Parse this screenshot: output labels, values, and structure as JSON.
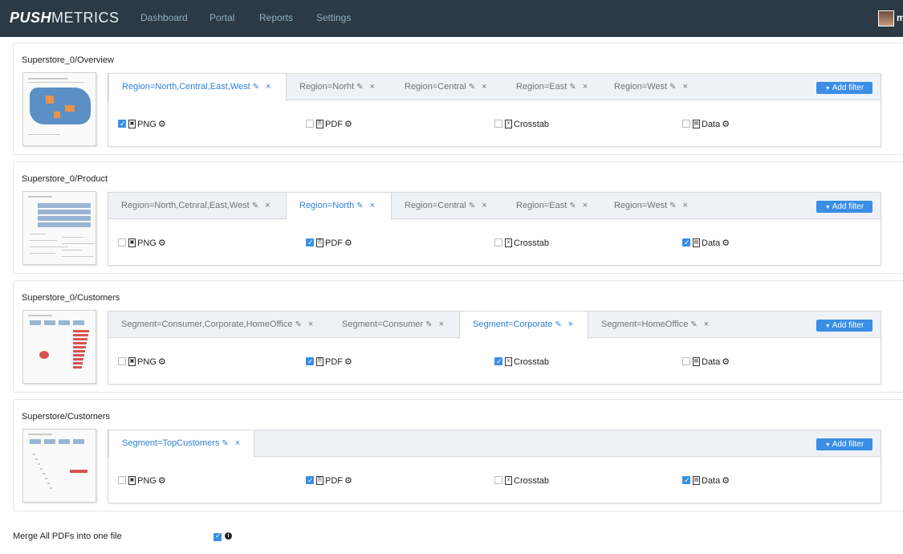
{
  "brand": {
    "bold": "PUSH",
    "light": "METRICS"
  },
  "nav": [
    "Dashboard",
    "Portal",
    "Reports",
    "Settings"
  ],
  "user_initial": "m",
  "sections": [
    {
      "title": "Superstore_0/Overview",
      "tabs": [
        "Region=North,Central,East,West",
        "Region=Norht",
        "Region=Central",
        "Region=East",
        "Region=West"
      ],
      "active_tab": 0,
      "add_filter": "Add filter",
      "options": [
        {
          "label": "PNG",
          "checked": true,
          "gear": true
        },
        {
          "label": "PDF",
          "checked": false,
          "gear": true
        },
        {
          "label": "Crosstab",
          "checked": false,
          "gear": false
        },
        {
          "label": "Data",
          "checked": false,
          "gear": true
        }
      ]
    },
    {
      "title": "Superstore_0/Product",
      "tabs": [
        "Region=North,Cetnral,East,West",
        "Region=North",
        "Region=Central",
        "Region=East",
        "Region=West"
      ],
      "active_tab": 1,
      "add_filter": "Add filter",
      "options": [
        {
          "label": "PNG",
          "checked": false,
          "gear": true
        },
        {
          "label": "PDF",
          "checked": true,
          "gear": true
        },
        {
          "label": "Crosstab",
          "checked": false,
          "gear": false
        },
        {
          "label": "Data",
          "checked": true,
          "gear": true
        }
      ]
    },
    {
      "title": "Superstore_0/Customers",
      "tabs": [
        "Segment=Consumer,Corporate,HomeOffice",
        "Segment=Consumer",
        "Segment=Corporate",
        "Segment=HomeOffice"
      ],
      "active_tab": 2,
      "add_filter": "Add filter",
      "options": [
        {
          "label": "PNG",
          "checked": false,
          "gear": true
        },
        {
          "label": "PDF",
          "checked": true,
          "gear": true
        },
        {
          "label": "Crosstab",
          "checked": true,
          "gear": false
        },
        {
          "label": "Data",
          "checked": false,
          "gear": true
        }
      ]
    },
    {
      "title": "Superstore/Customers",
      "tabs": [
        "Segment=TopCustomers"
      ],
      "active_tab": 0,
      "add_filter": "Add filter",
      "options": [
        {
          "label": "PNG",
          "checked": false,
          "gear": true
        },
        {
          "label": "PDF",
          "checked": true,
          "gear": true
        },
        {
          "label": "Crosstab",
          "checked": false,
          "gear": false
        },
        {
          "label": "Data",
          "checked": true,
          "gear": true
        }
      ]
    }
  ],
  "merge": {
    "label": "Merge All PDFs into one file",
    "checked": true
  },
  "colors": {
    "topbar": "#2b3a44",
    "accent": "#3a8ee6",
    "active_tab_text": "#2f7fd6"
  }
}
